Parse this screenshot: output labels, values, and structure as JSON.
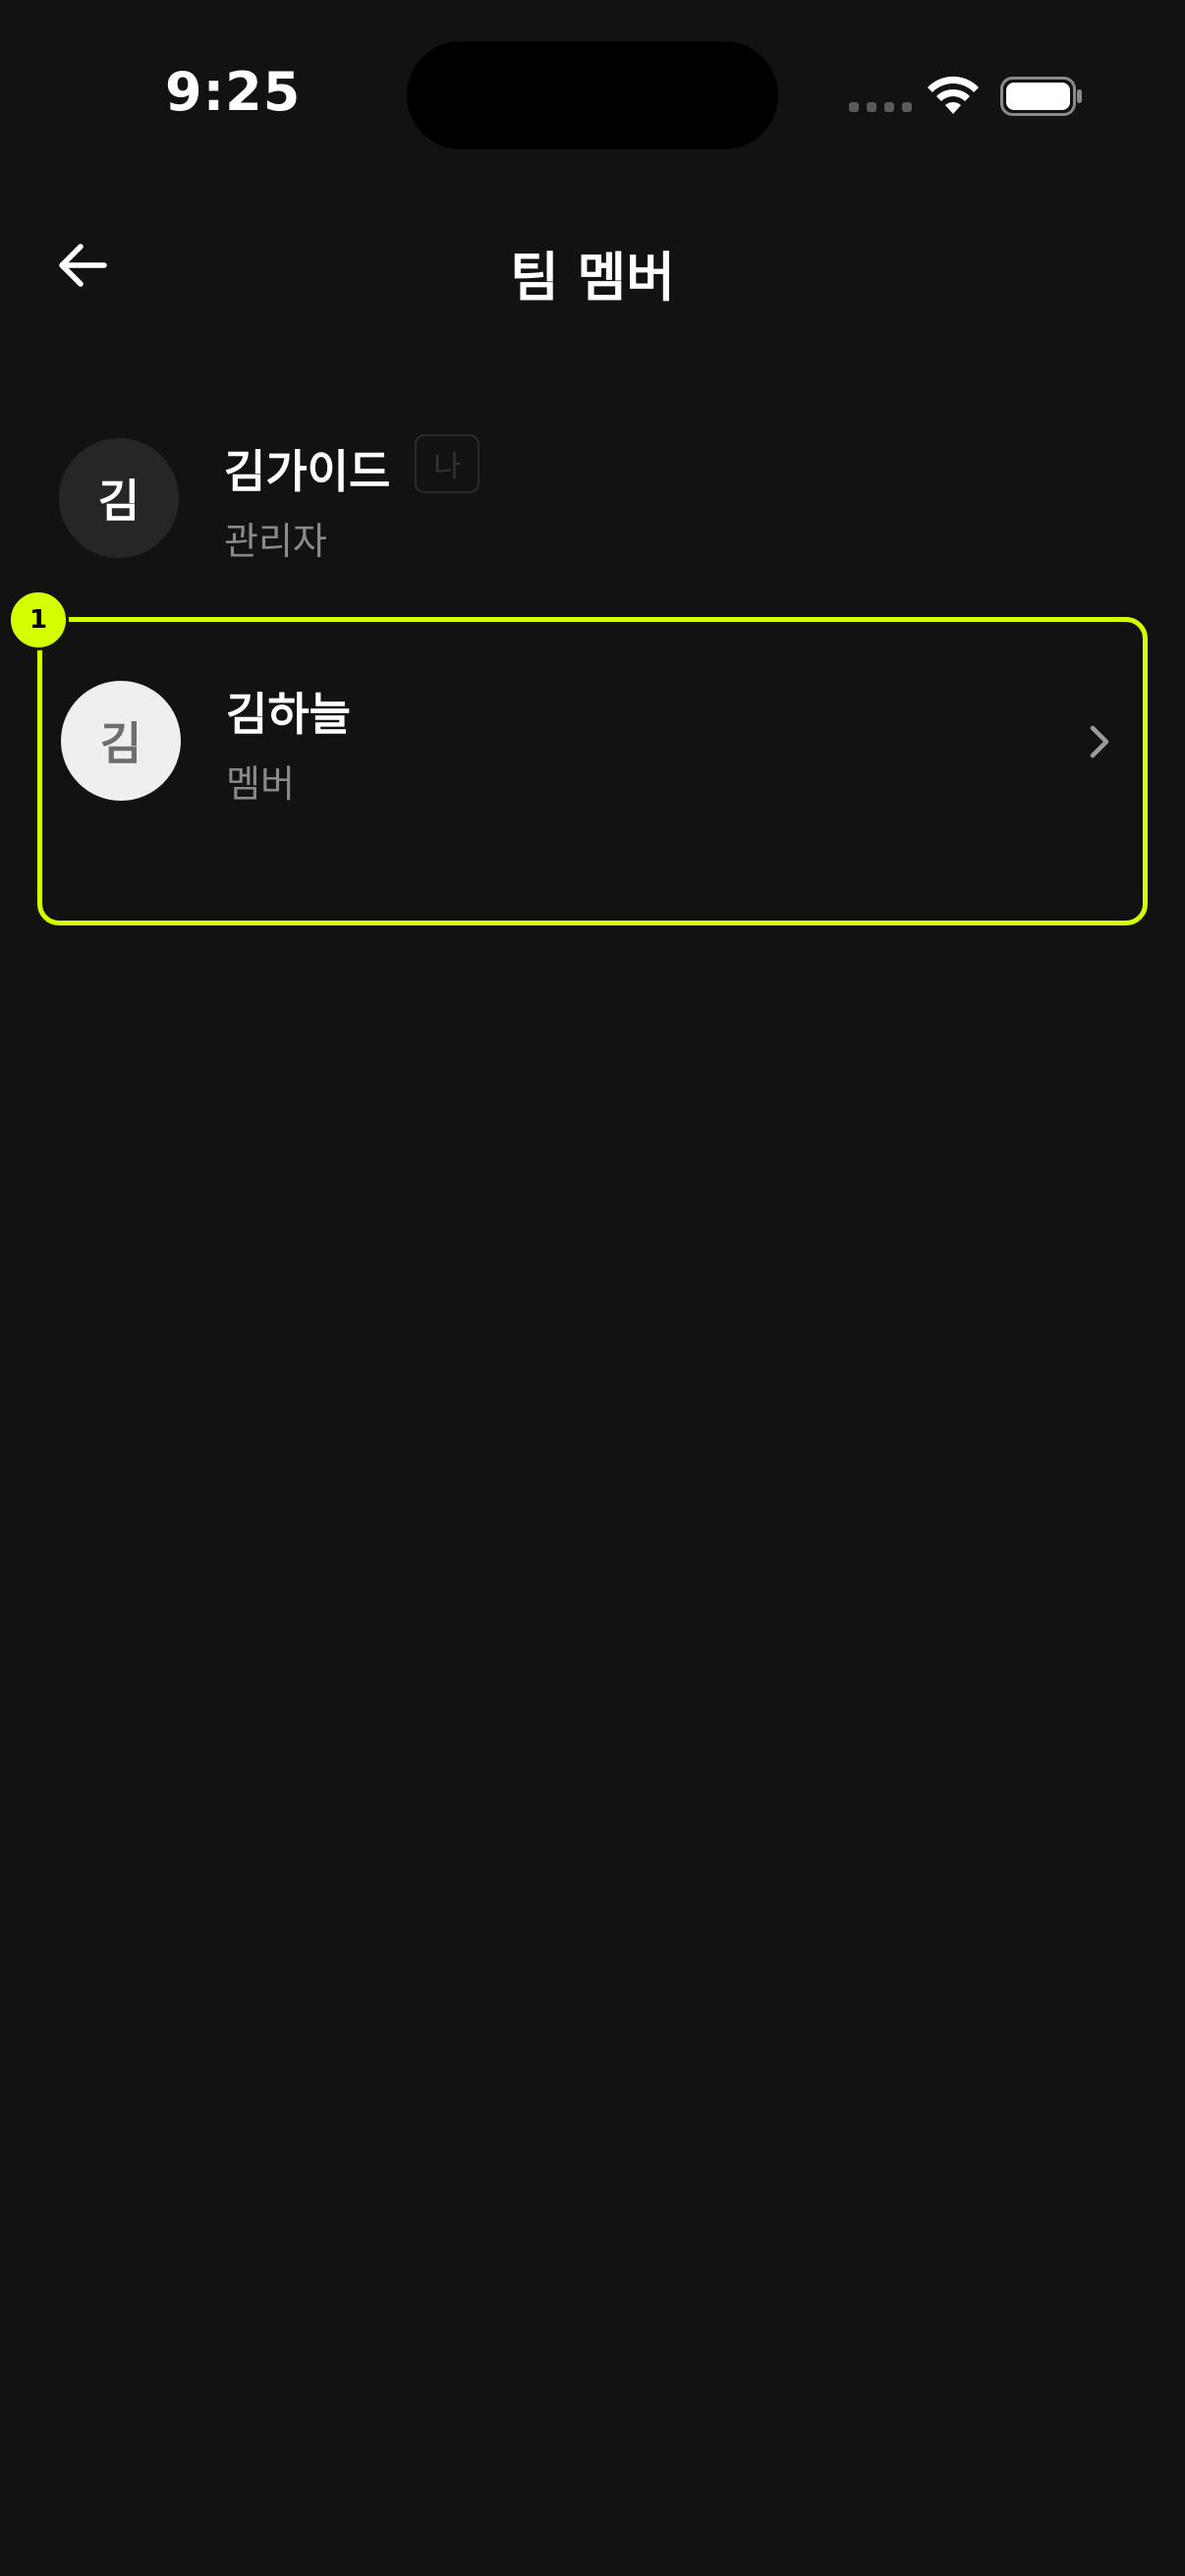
{
  "status_bar": {
    "time": "9:25",
    "icons": [
      "signal-icon",
      "wifi-icon",
      "battery-icon"
    ]
  },
  "header": {
    "title": "팀 멤버",
    "back_icon": "arrow-left-icon"
  },
  "members": [
    {
      "initial": "김",
      "name": "김가이드",
      "role": "관리자",
      "badge": "나"
    },
    {
      "initial": "김",
      "name": "김하늘",
      "role": "멤버",
      "action_icon": "chevron-right-icon"
    }
  ],
  "annotation": {
    "marker": "1",
    "accent_color": "#d4ff00"
  },
  "colors": {
    "background": "#121212",
    "text_primary": "#ffffff",
    "text_secondary": "#8a8a8a",
    "highlight": "#d4ff00"
  }
}
